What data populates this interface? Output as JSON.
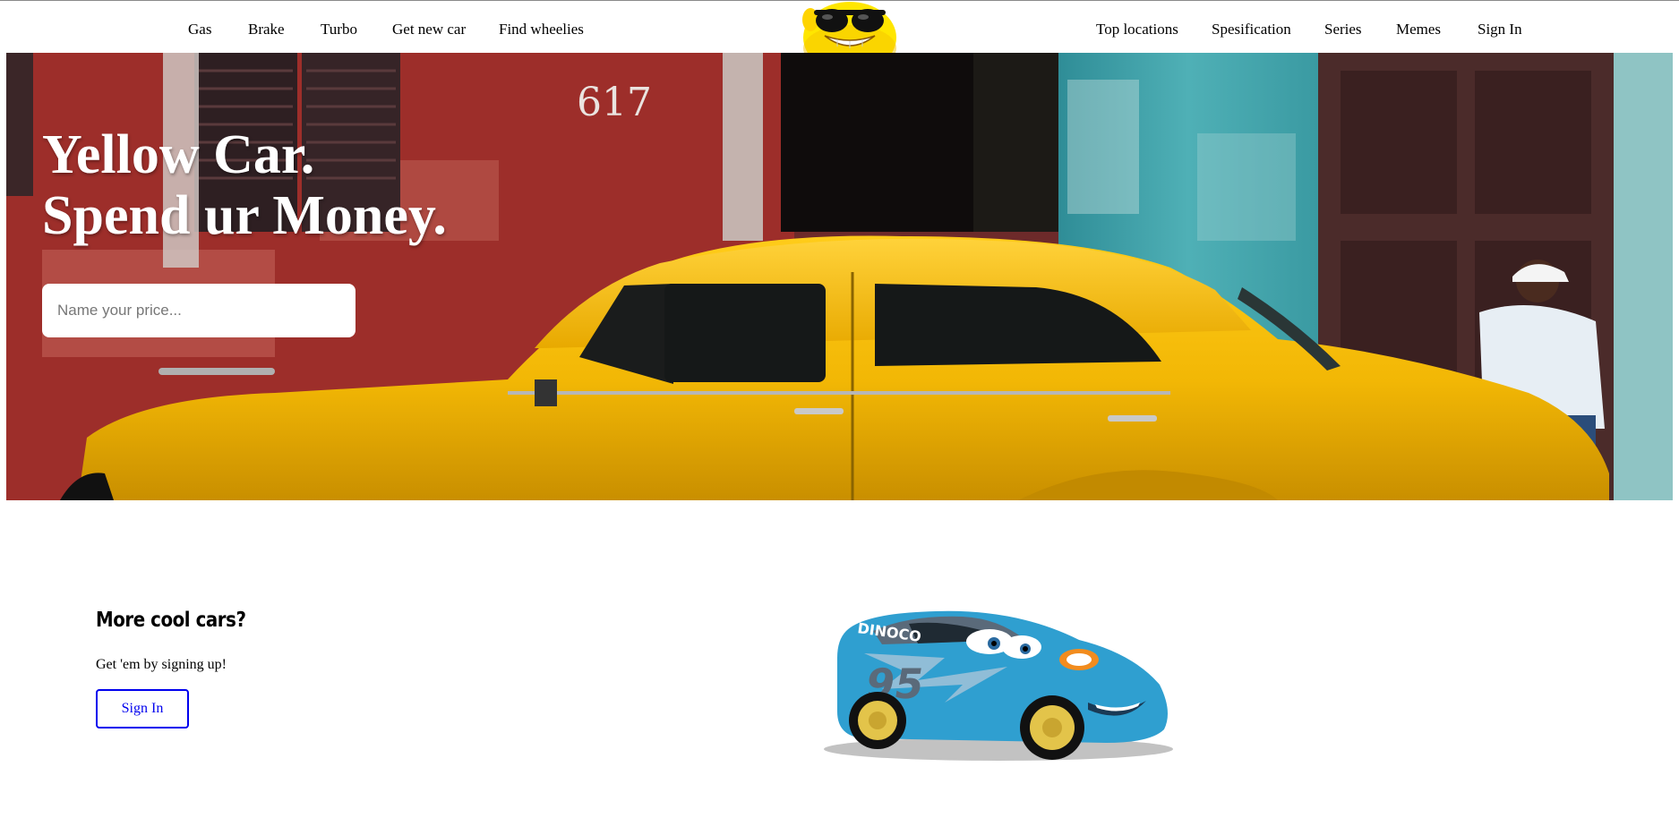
{
  "nav": {
    "left_links": [
      "Gas",
      "Brake",
      "Turbo",
      "Get new car",
      "Find wheelies"
    ],
    "right_links": [
      "Top locations",
      "Spesification",
      "Series",
      "Memes",
      "Sign In"
    ],
    "logo_icon": "sunglasses-smiley-icon"
  },
  "hero": {
    "title_line1": "Yellow Car.",
    "title_line2": "Spend ur Money.",
    "price_placeholder": "Name your price...",
    "background": "yellow-vintage-car-photo",
    "door_number": "617"
  },
  "cta": {
    "heading": "More cool cars?",
    "text": "Get 'em by signing up!",
    "button_label": "Sign In",
    "illustration": "blue-race-car-95-cartoon",
    "car_number": "95",
    "car_text": "DINOCO"
  },
  "colors": {
    "link_blue": "#0000ee",
    "car_yellow": "#f2b705",
    "wall_red": "#a3302c",
    "wall_teal": "#3f9aa3",
    "cartoon_blue": "#2f9fd0"
  }
}
